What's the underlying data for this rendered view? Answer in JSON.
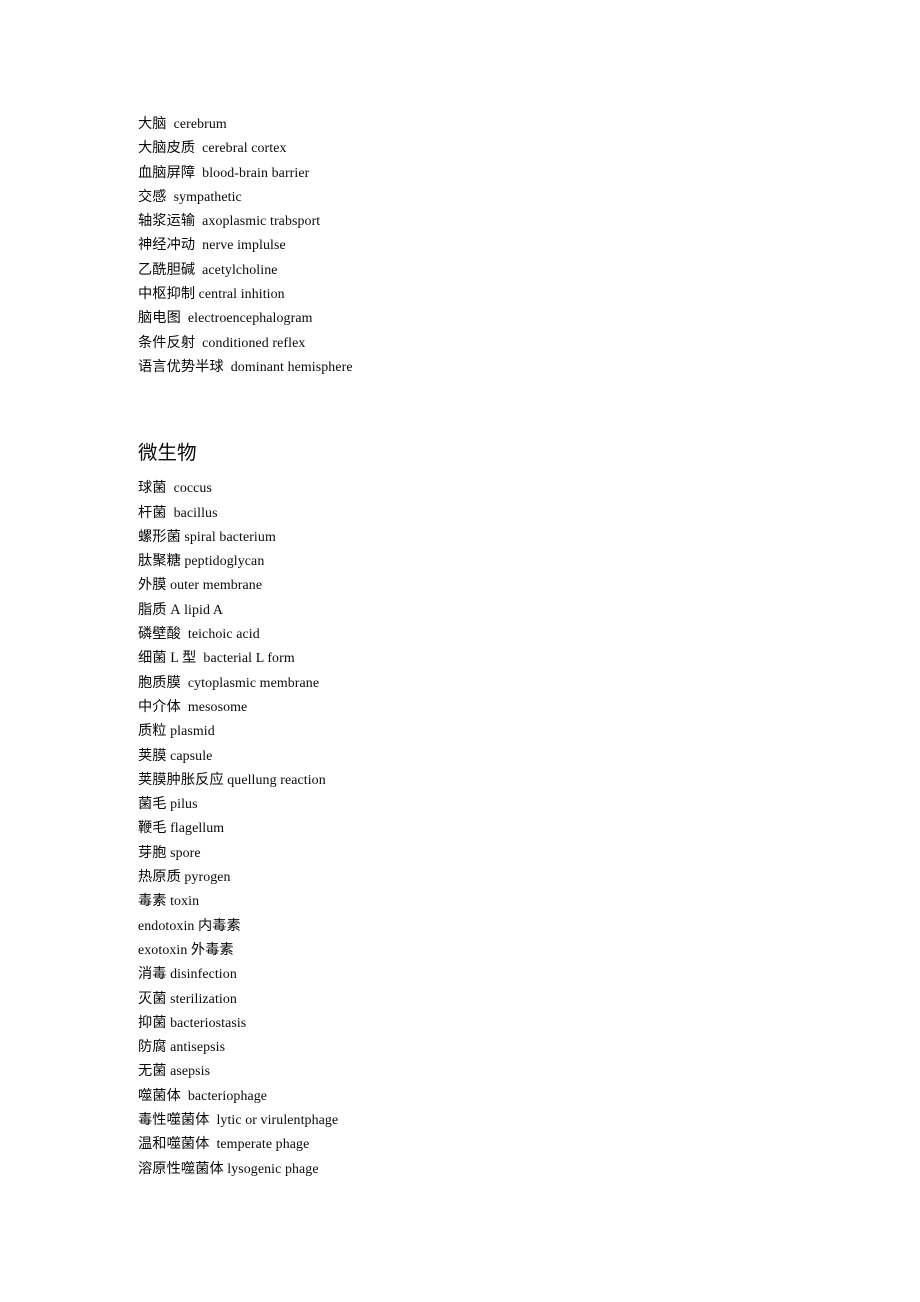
{
  "document": {
    "page_background": "#ffffff",
    "text_color": "#0a0a0a",
    "sections": [
      {
        "id": "neuro",
        "heading": null,
        "entries": [
          {
            "cjk": "大脑",
            "gap": "  ",
            "latin": "cerebrum"
          },
          {
            "cjk": "大脑皮质",
            "gap": "  ",
            "latin": "cerebral cortex"
          },
          {
            "cjk": "血脑屏障",
            "gap": "  ",
            "latin": "blood-brain barrier"
          },
          {
            "cjk": "交感",
            "gap": "  ",
            "latin": "sympathetic"
          },
          {
            "cjk": "轴浆运输",
            "gap": "  ",
            "latin": "axoplasmic trabsport"
          },
          {
            "cjk": "神经冲动",
            "gap": "  ",
            "latin": "nerve implulse"
          },
          {
            "cjk": "乙酰胆碱",
            "gap": "  ",
            "latin": "acetylcholine"
          },
          {
            "cjk": "中枢抑制",
            "gap": " ",
            "latin": "central inhition"
          },
          {
            "cjk": "脑电图",
            "gap": "  ",
            "latin": "electroencephalogram"
          },
          {
            "cjk": "条件反射",
            "gap": "  ",
            "latin": "conditioned reflex"
          },
          {
            "cjk": "语言优势半球",
            "gap": "  ",
            "latin": "dominant hemisphere"
          }
        ]
      },
      {
        "id": "microbiology",
        "heading": "微生物",
        "entries": [
          {
            "cjk": "球菌",
            "gap": "  ",
            "latin": "coccus"
          },
          {
            "cjk": "杆菌",
            "gap": "  ",
            "latin": "bacillus"
          },
          {
            "cjk": "螺形菌",
            "gap": " ",
            "latin": "spiral bacterium"
          },
          {
            "cjk": "肽聚糖",
            "gap": " ",
            "latin": "peptidoglycan"
          },
          {
            "cjk": "外膜",
            "gap": " ",
            "latin": "outer membrane"
          },
          {
            "cjk": "脂质 A",
            "gap": " ",
            "latin": "lipid A"
          },
          {
            "cjk": "磷壁酸",
            "gap": "  ",
            "latin": "teichoic acid"
          },
          {
            "cjk": "细菌 L 型",
            "gap": "  ",
            "latin": "bacterial L form"
          },
          {
            "cjk": "胞质膜",
            "gap": "  ",
            "latin": "cytoplasmic membrane"
          },
          {
            "cjk": "中介体",
            "gap": "  ",
            "latin": "mesosome"
          },
          {
            "cjk": "质粒",
            "gap": " ",
            "latin": "plasmid"
          },
          {
            "cjk": "荚膜",
            "gap": " ",
            "latin": "capsule"
          },
          {
            "cjk": "荚膜肿胀反应",
            "gap": " ",
            "latin": "quellung reaction"
          },
          {
            "cjk": "菌毛",
            "gap": " ",
            "latin": "pilus"
          },
          {
            "cjk": "鞭毛",
            "gap": " ",
            "latin": "flagellum"
          },
          {
            "cjk": "芽胞",
            "gap": " ",
            "latin": "spore"
          },
          {
            "cjk": "热原质",
            "gap": " ",
            "latin": "pyrogen"
          },
          {
            "cjk": "毒素",
            "gap": " ",
            "latin": "toxin"
          },
          {
            "latin": "endotoxin",
            "gap": " ",
            "cjk": "内毒素",
            "reversed": true
          },
          {
            "latin": "exotoxin",
            "gap": " ",
            "cjk": "外毒素",
            "reversed": true
          },
          {
            "cjk": "消毒",
            "gap": " ",
            "latin": "disinfection"
          },
          {
            "cjk": "灭菌",
            "gap": " ",
            "latin": "sterilization"
          },
          {
            "cjk": "抑菌",
            "gap": " ",
            "latin": "bacteriostasis"
          },
          {
            "cjk": "防腐",
            "gap": " ",
            "latin": "antisepsis"
          },
          {
            "cjk": "无菌",
            "gap": " ",
            "latin": "asepsis"
          },
          {
            "cjk": "噬菌体",
            "gap": "  ",
            "latin": "bacteriophage"
          },
          {
            "cjk": "毒性噬菌体",
            "gap": "  ",
            "latin": "lytic or virulentphage"
          },
          {
            "cjk": "温和噬菌体",
            "gap": "  ",
            "latin": "temperate phage"
          },
          {
            "cjk": "溶原性噬菌体",
            "gap": " ",
            "latin": "lysogenic phage"
          }
        ]
      }
    ]
  }
}
